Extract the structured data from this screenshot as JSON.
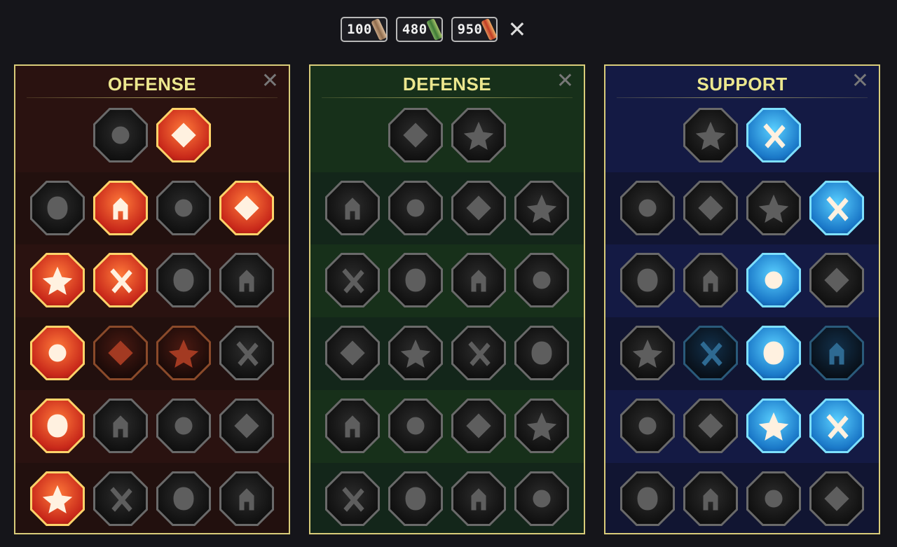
{
  "resources": [
    {
      "value": "100",
      "icon": "tan-scroll-icon"
    },
    {
      "value": "480",
      "icon": "green-scroll-icon"
    },
    {
      "value": "950",
      "icon": "red-scroll-icon"
    }
  ],
  "close_label": "✕",
  "panels": [
    {
      "title": "OFFENSE",
      "close": "✕",
      "accent": "#ece78e",
      "frame": "#d9cc7a",
      "rows": [
        [
          {
            "icon": "crossed-swords-icon",
            "state": "off"
          },
          {
            "icon": "flaming-dagger-icon",
            "state": "active"
          }
        ],
        [
          {
            "icon": "demon-silhouette-icon",
            "state": "off"
          },
          {
            "icon": "spear-burst-icon",
            "state": "active"
          },
          {
            "icon": "shield-strike-icon",
            "state": "off"
          },
          {
            "icon": "bleeding-heart-icon",
            "state": "active"
          }
        ],
        [
          {
            "icon": "arrow-pierced-warrior-icon",
            "state": "active"
          },
          {
            "icon": "fanged-mouth-icon",
            "state": "active"
          },
          {
            "icon": "skull-slash-icon",
            "state": "off"
          },
          {
            "icon": "scythe-hand-icon",
            "state": "off"
          }
        ],
        [
          {
            "icon": "dripping-sword-icon",
            "state": "active"
          },
          {
            "icon": "fist-hammer-icon",
            "state": "dim"
          },
          {
            "icon": "axe-icon",
            "state": "dim"
          },
          {
            "icon": "chain-lightning-icon",
            "state": "off"
          }
        ],
        [
          {
            "icon": "sword-impact-icon",
            "state": "active"
          },
          {
            "icon": "twin-skulls-icon",
            "state": "off"
          },
          {
            "icon": "sword-ring-icon",
            "state": "off"
          },
          {
            "icon": "shocked-figure-icon",
            "state": "off"
          }
        ],
        [
          {
            "icon": "sparkling-blade-icon",
            "state": "active"
          },
          {
            "icon": "knight-helmet-icon",
            "state": "off"
          },
          {
            "icon": "giant-warrior-icon",
            "state": "off"
          },
          {
            "icon": "impaled-skull-icon",
            "state": "off"
          }
        ]
      ]
    },
    {
      "title": "DEFENSE",
      "close": "✕",
      "accent": "#ece78e",
      "frame": "#d9cc7a",
      "rows": [
        [
          {
            "icon": "armor-plates-icon",
            "state": "off"
          },
          {
            "icon": "raised-fist-icon",
            "state": "off"
          }
        ],
        [
          {
            "icon": "chevron-shield-icon",
            "state": "off"
          },
          {
            "icon": "anatomical-heart-icon",
            "state": "off"
          },
          {
            "icon": "muscled-warrior-icon",
            "state": "off"
          },
          {
            "icon": "blocked-blade-icon",
            "state": "off"
          }
        ],
        [
          {
            "icon": "mirrored-figures-icon",
            "state": "off"
          },
          {
            "icon": "shield-bearer-icon",
            "state": "off"
          },
          {
            "icon": "skull-heart-icon",
            "state": "off"
          },
          {
            "icon": "hooded-figure-icon",
            "state": "off"
          }
        ],
        [
          {
            "icon": "crowd-icon",
            "state": "off"
          },
          {
            "icon": "hourglass-icon",
            "state": "off"
          },
          {
            "icon": "open-hand-icon",
            "state": "off"
          },
          {
            "icon": "bull-head-icon",
            "state": "off"
          }
        ],
        [
          {
            "icon": "dash-runner-icon",
            "state": "off"
          },
          {
            "icon": "triple-drops-icon",
            "state": "off"
          },
          {
            "icon": "radiant-skull-icon",
            "state": "off"
          },
          {
            "icon": "deflect-strike-icon",
            "state": "off"
          }
        ],
        [
          {
            "icon": "spiked-warrior-icon",
            "state": "off"
          },
          {
            "icon": "winged-shield-icon",
            "state": "off"
          },
          {
            "icon": "bearded-skull-icon",
            "state": "off"
          },
          {
            "icon": "flexing-figure-icon",
            "state": "off"
          }
        ]
      ]
    },
    {
      "title": "SUPPORT",
      "close": "✕",
      "accent": "#ece78e",
      "frame": "#d9cc7a",
      "rows": [
        [
          {
            "icon": "heart-plus-icon",
            "state": "off"
          },
          {
            "icon": "speed-gauge-icon",
            "state": "active"
          }
        ],
        [
          {
            "icon": "praying-hands-icon",
            "state": "off"
          },
          {
            "icon": "shield-waves-icon",
            "state": "off"
          },
          {
            "icon": "smoking-skull-icon",
            "state": "off"
          },
          {
            "icon": "breaking-chain-icon",
            "state": "active"
          }
        ],
        [
          {
            "icon": "blessed-figure-icon",
            "state": "off"
          },
          {
            "icon": "lightning-bolt-icon",
            "state": "off"
          },
          {
            "icon": "cracked-ground-icon",
            "state": "active"
          },
          {
            "icon": "shadow-figures-icon",
            "state": "off"
          }
        ],
        [
          {
            "icon": "chained-heart-icon",
            "state": "off"
          },
          {
            "icon": "comet-icon",
            "state": "dim"
          },
          {
            "icon": "open-book-icon",
            "state": "active"
          },
          {
            "icon": "glaring-eyes-icon",
            "state": "dim"
          }
        ],
        [
          {
            "icon": "compass-star-icon",
            "state": "off"
          },
          {
            "icon": "speed-boot-icon",
            "state": "off"
          },
          {
            "icon": "seeing-eye-icon",
            "state": "active"
          },
          {
            "icon": "voodoo-doll-icon",
            "state": "active"
          }
        ],
        [
          {
            "icon": "potion-flask-icon",
            "state": "off"
          },
          {
            "icon": "caped-skull-icon",
            "state": "off"
          },
          {
            "icon": "flame-fist-icon",
            "state": "off"
          },
          {
            "icon": "eagle-head-icon",
            "state": "off"
          }
        ]
      ]
    }
  ],
  "theme_colors": {
    "offense_bg": [
      "#2a1210",
      "#22100e"
    ],
    "defense_bg": [
      "#17301a",
      "#13261a"
    ],
    "support_bg": [
      "#141a44",
      "#111532"
    ]
  }
}
